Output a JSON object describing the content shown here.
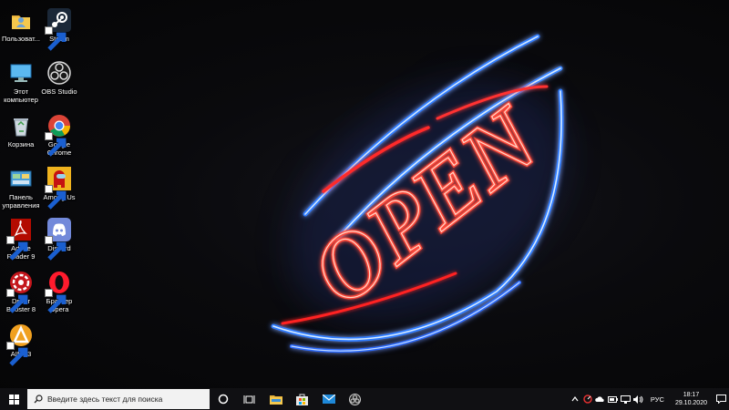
{
  "desktop": {
    "wallpaper_sign": "OPEN",
    "icons": [
      {
        "name": "user-folder",
        "label": "Пользоват..."
      },
      {
        "name": "steam",
        "label": "Steam"
      },
      {
        "name": "this-pc",
        "label": "Этот\nкомпьютер"
      },
      {
        "name": "obs-studio",
        "label": "OBS Studio"
      },
      {
        "name": "recycle-bin",
        "label": "Корзина"
      },
      {
        "name": "google-chrome",
        "label": "Google\nChrome"
      },
      {
        "name": "control-panel",
        "label": "Панель\nуправления"
      },
      {
        "name": "among-us",
        "label": "Among Us"
      },
      {
        "name": "adobe-reader",
        "label": "Adobe\nReader 9"
      },
      {
        "name": "discord",
        "label": "Discord"
      },
      {
        "name": "driver-booster",
        "label": "Driver\nBooster 8"
      },
      {
        "name": "opera",
        "label": "Браузер\nOpera"
      },
      {
        "name": "aimp",
        "label": "AIMP3"
      }
    ]
  },
  "taskbar": {
    "search": {
      "placeholder": "Введите здесь текст для поиска"
    },
    "pinned_apps": [
      "cortana",
      "task-view",
      "file-explorer",
      "microsoft-store",
      "mail",
      "obs-studio"
    ],
    "tray": {
      "language": "РУС",
      "time": "18:17",
      "date": "29.10.2020"
    }
  }
}
